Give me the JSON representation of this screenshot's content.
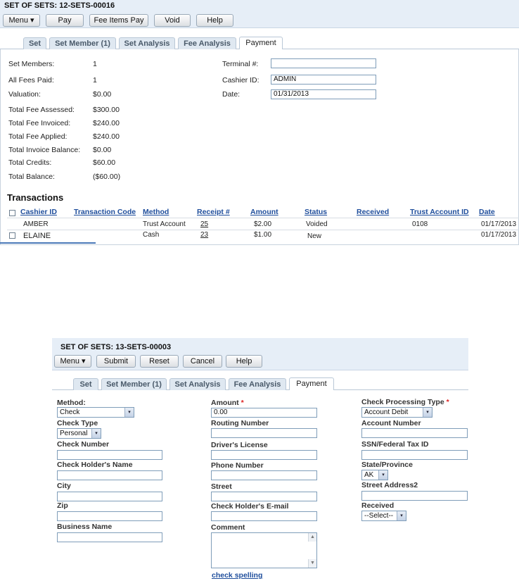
{
  "top": {
    "title": "SET OF SETS: 12-SETS-00016",
    "toolbar": {
      "menu": "Menu ▾",
      "pay": "Pay",
      "fee_items_pay": "Fee Items Pay",
      "void": "Void",
      "help": "Help"
    },
    "tabs": [
      "Set",
      "Set Member (1)",
      "Set Analysis",
      "Fee Analysis",
      "Payment"
    ],
    "summary": [
      {
        "label": "Set Members:",
        "value": "1"
      },
      {
        "label": "All Fees Paid:",
        "value": "1"
      },
      {
        "label": "Valuation:",
        "value": "$0.00"
      },
      {
        "label": "Total Fee Assessed:",
        "value": "$300.00"
      },
      {
        "label": "Total Fee Invoiced:",
        "value": "$240.00"
      },
      {
        "label": "Total Fee Applied:",
        "value": "$240.00"
      },
      {
        "label": "Total Invoice Balance:",
        "value": "$0.00"
      },
      {
        "label": "Total Credits:",
        "value": "$60.00"
      },
      {
        "label": "Total Balance:",
        "value": "($60.00)"
      }
    ],
    "terminal": {
      "label": "Terminal #:",
      "value": ""
    },
    "cashier": {
      "label": "Cashier ID:",
      "value": "ADMIN"
    },
    "date": {
      "label": "Date:",
      "value": "01/31/2013"
    },
    "transactions": {
      "title": "Transactions",
      "columns": [
        "Cashier ID",
        "Transaction Code",
        "Method",
        "Receipt #",
        "Amount",
        "Status",
        "Received",
        "Trust Account ID",
        "Date"
      ],
      "rows": [
        {
          "cashier": "AMBER",
          "code": "",
          "method": "Trust Account",
          "receipt": "25",
          "amount": "$2.00",
          "status": "Voided",
          "received": "",
          "trust": "0108",
          "date": "01/17/2013"
        },
        {
          "cashier": "ELAINE",
          "code": "",
          "method": "Cash",
          "receipt": "23",
          "amount": "$1.00",
          "status": "New",
          "received": "",
          "trust": "",
          "date": "01/17/2013"
        }
      ]
    }
  },
  "bottom": {
    "title": "SET OF SETS: 13-SETS-00003",
    "toolbar": {
      "menu": "Menu ▾",
      "submit": "Submit",
      "reset": "Reset",
      "cancel": "Cancel",
      "help": "Help"
    },
    "tabs": [
      "Set",
      "Set Member (1)",
      "Set Analysis",
      "Fee Analysis",
      "Payment"
    ],
    "form": {
      "method": {
        "label": "Method:",
        "value": "Check"
      },
      "check_type": {
        "label": "Check Type",
        "value": "Personal"
      },
      "check_number": {
        "label": "Check Number",
        "value": ""
      },
      "check_holder_name": {
        "label": "Check Holder's Name",
        "value": ""
      },
      "city": {
        "label": "City",
        "value": ""
      },
      "zip": {
        "label": "Zip",
        "value": ""
      },
      "business_name": {
        "label": "Business Name",
        "value": ""
      },
      "amount": {
        "label": "Amount",
        "required": "*",
        "value": "0.00"
      },
      "routing_number": {
        "label": "Routing Number",
        "value": ""
      },
      "drivers_license": {
        "label": "Driver's License",
        "value": ""
      },
      "phone_number": {
        "label": "Phone Number",
        "value": ""
      },
      "street": {
        "label": "Street",
        "value": ""
      },
      "check_holder_email": {
        "label": "Check Holder's E-mail",
        "value": ""
      },
      "comment": {
        "label": "Comment",
        "value": ""
      },
      "check_spelling": "check spelling",
      "check_processing_type": {
        "label": "Check Processing Type",
        "required": "*",
        "value": "Account Debit"
      },
      "account_number": {
        "label": "Account Number",
        "value": ""
      },
      "ssn_tax_id": {
        "label": "SSN/Federal Tax ID",
        "value": ""
      },
      "state_province": {
        "label": "State/Province",
        "value": "AK"
      },
      "street_address2": {
        "label": "Street Address2",
        "value": ""
      },
      "received": {
        "label": "Received",
        "value": "--Select--"
      }
    }
  },
  "icons": {
    "dropdown": "▾",
    "scroll_up": "▲",
    "scroll_down": "▼"
  },
  "colors": {
    "titlebar": "#e6eef7",
    "link": "#1f4e9c",
    "required": "#d22222"
  }
}
